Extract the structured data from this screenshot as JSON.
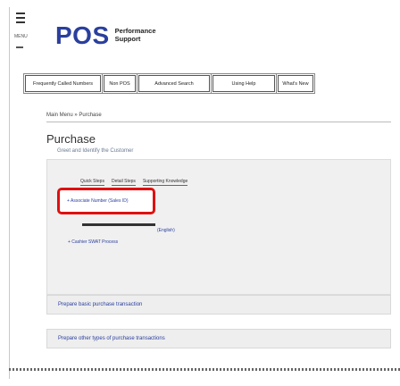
{
  "sidebar": {
    "menu_label": "MENU"
  },
  "logo": {
    "name": "POS",
    "subtitle_line1": "Performance",
    "subtitle_line2": "Support"
  },
  "tabs": [
    {
      "label": "Frequently Called Numbers"
    },
    {
      "label": "Non POS"
    },
    {
      "label": "Advanced Search"
    },
    {
      "label": "Using Help"
    },
    {
      "label": "What's New"
    }
  ],
  "breadcrumb": {
    "text": "Main Menu » Purchase"
  },
  "page": {
    "title": "Purchase",
    "subtitle": "Greet and Identify the Customer"
  },
  "inner_tabs": [
    {
      "label": "Quick Steps"
    },
    {
      "label": "Detail Steps"
    },
    {
      "label": "Supporting Knowledge"
    }
  ],
  "highlighted_item": {
    "text": "+ Associate Number (Sales ID)"
  },
  "english_text": "(English)",
  "cashier_item": {
    "text": "+ Cashier SWAT Process"
  },
  "sections": [
    {
      "label": "Prepare basic purchase transaction"
    },
    {
      "label": "Prepare other types of purchase transactions"
    }
  ]
}
